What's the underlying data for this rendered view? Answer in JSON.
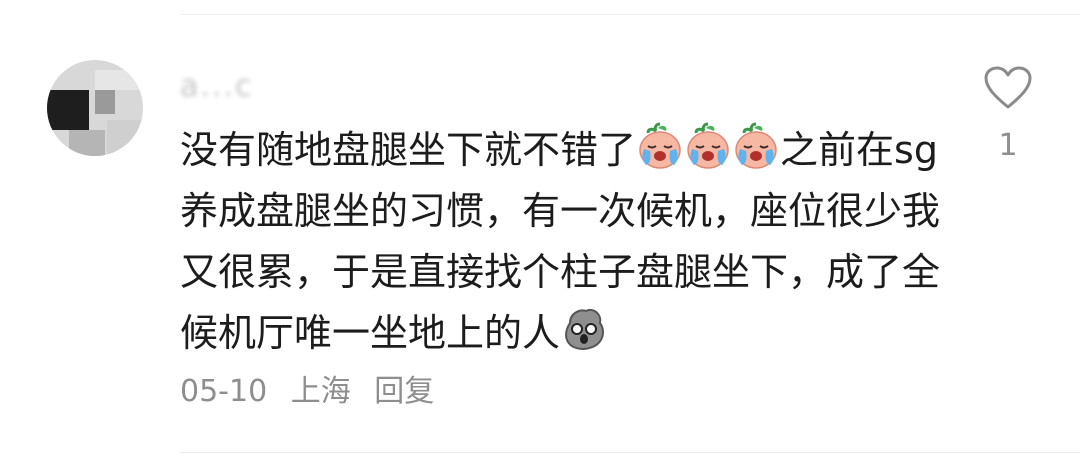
{
  "comment": {
    "username": "a...c",
    "segments": [
      {
        "type": "text",
        "value": "没有随地盘腿坐下就不错了"
      },
      {
        "type": "emoji",
        "name": "crying-face-emoji"
      },
      {
        "type": "emoji",
        "name": "crying-face-emoji"
      },
      {
        "type": "emoji",
        "name": "crying-face-emoji"
      },
      {
        "type": "text",
        "value": "之前在sg养成盘腿坐的习惯，有一次候机，座位很少我又很累，于是直接找个柱子盘腿坐下，成了全候机厅唯一坐地上的人"
      },
      {
        "type": "emoji",
        "name": "shocked-face-emoji"
      }
    ],
    "date": "05-10",
    "location": "上海",
    "reply_label": "回复",
    "like_count": "1",
    "like_icon": "heart-icon"
  }
}
